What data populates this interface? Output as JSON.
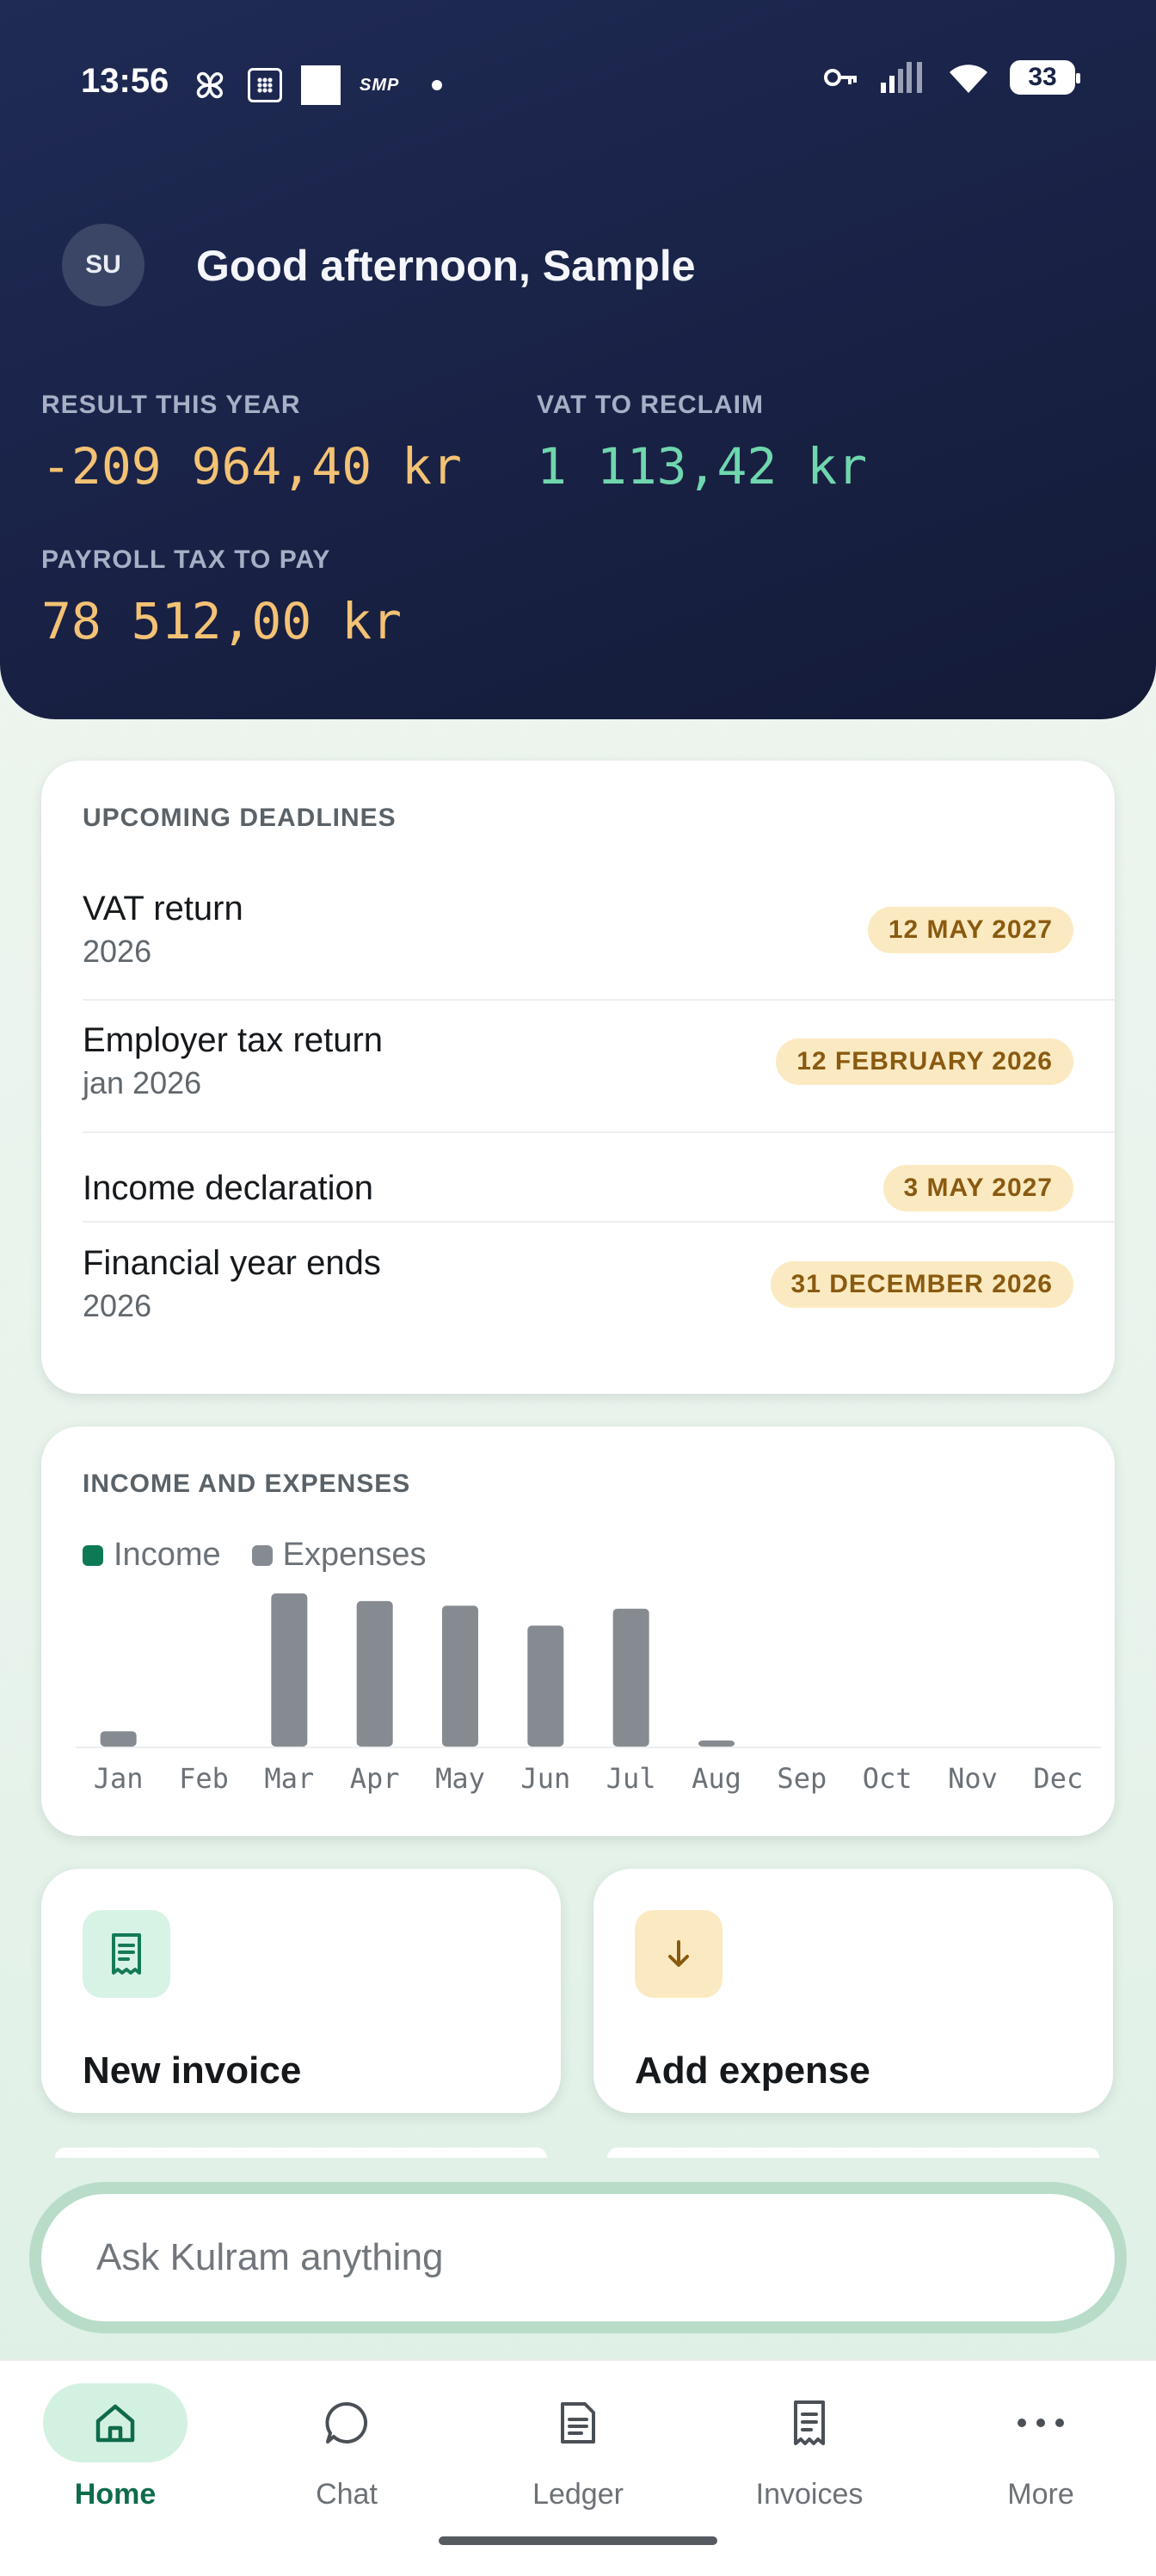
{
  "status_bar": {
    "time": "13:56",
    "smp": "SMP",
    "battery": "33"
  },
  "header": {
    "avatar_initials": "SU",
    "greeting": "Good afternoon, Sample",
    "stats": {
      "result_label": "RESULT THIS YEAR",
      "result_value": "-209 964,40 kr",
      "vat_label": "VAT TO RECLAIM",
      "vat_value": "1 113,42 kr",
      "payroll_label": "PAYROLL TAX TO PAY",
      "payroll_value": "78 512,00 kr"
    },
    "colors": {
      "amount_negative": "#f3c274",
      "amount_positive": "#6fd6ad"
    }
  },
  "deadlines": {
    "title": "UPCOMING DEADLINES",
    "items": [
      {
        "name": "VAT return",
        "sub": "2026",
        "date": "12 MAY 2027"
      },
      {
        "name": "Employer tax return",
        "sub": "jan 2026",
        "date": "12 FEBRUARY 2026"
      },
      {
        "name": "Income declaration",
        "sub": "",
        "date": "3 MAY 2027"
      },
      {
        "name": "Financial year ends",
        "sub": "2026",
        "date": "31 DECEMBER 2026"
      }
    ]
  },
  "chart_data": {
    "type": "bar",
    "title": "INCOME AND EXPENSES",
    "categories": [
      "Jan",
      "Feb",
      "Mar",
      "Apr",
      "May",
      "Jun",
      "Jul",
      "Aug",
      "Sep",
      "Oct",
      "Nov",
      "Dec"
    ],
    "series": [
      {
        "name": "Income",
        "color": "#0e7a55",
        "values": [
          0,
          0,
          0,
          0,
          0,
          0,
          0,
          0,
          0,
          0,
          0,
          0
        ]
      },
      {
        "name": "Expenses",
        "color": "#868b91",
        "values": [
          10,
          0,
          100,
          95,
          92,
          79,
          90,
          4,
          0,
          0,
          0,
          0
        ]
      }
    ],
    "ylim": [
      0,
      100
    ],
    "grid": false,
    "legend": "top-left"
  },
  "actions": {
    "new_invoice": {
      "label": "New invoice",
      "icon": "receipt-icon",
      "bg": "#d7f3e5",
      "fg": "#157a57"
    },
    "add_expense": {
      "label": "Add expense",
      "icon": "arrow-down-icon",
      "bg": "#fbeac1",
      "fg": "#8a5a10"
    }
  },
  "ask": {
    "placeholder": "Ask Kulram anything"
  },
  "nav": {
    "items": [
      {
        "label": "Home",
        "icon": "home-icon",
        "active": true
      },
      {
        "label": "Chat",
        "icon": "chat-bubble-icon",
        "active": false
      },
      {
        "label": "Ledger",
        "icon": "ledger-icon",
        "active": false
      },
      {
        "label": "Invoices",
        "icon": "invoice-icon",
        "active": false
      },
      {
        "label": "More",
        "icon": "more-dots-icon",
        "active": false
      }
    ]
  }
}
